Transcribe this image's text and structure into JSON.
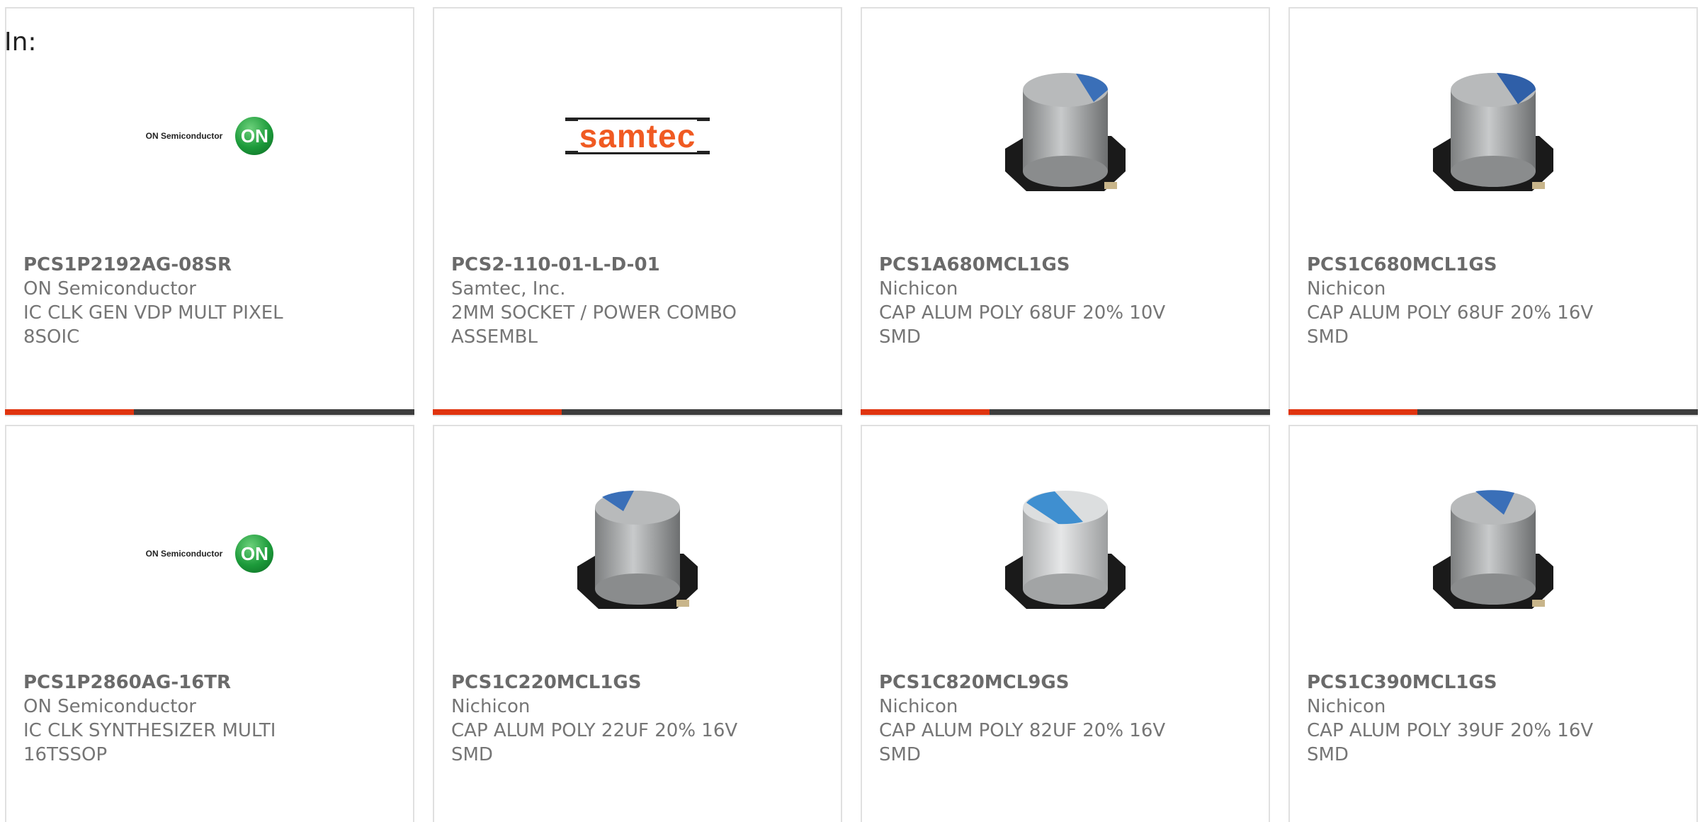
{
  "header": {
    "in_label": "In:"
  },
  "colors": {
    "accent": "#e0340f",
    "bar": "#3d3d3d",
    "card_border": "#e0e0e0",
    "text": "#757575"
  },
  "products": [
    {
      "part_number": "PCS1P2192AG-08SR",
      "manufacturer": "ON Semiconductor",
      "description": "IC CLK GEN VDP MULT PIXEL\n8SOIC",
      "image": "on-semiconductor-logo",
      "logo_text": "ON Semiconductor",
      "logo_mark": "ON"
    },
    {
      "part_number": "PCS2-110-01-L-D-01",
      "manufacturer": "Samtec, Inc.",
      "description": "2MM SOCKET / POWER COMBO\nASSEMBL",
      "image": "samtec-logo",
      "logo_text": "samtec"
    },
    {
      "part_number": "PCS1A680MCL1GS",
      "manufacturer": "Nichicon",
      "description": "CAP ALUM POLY 68UF 20% 10V\nSMD",
      "image": "smd-capacitor"
    },
    {
      "part_number": "PCS1C680MCL1GS",
      "manufacturer": "Nichicon",
      "description": "CAP ALUM POLY 68UF 20% 16V\nSMD",
      "image": "smd-capacitor"
    },
    {
      "part_number": "PCS1P2860AG-16TR",
      "manufacturer": "ON Semiconductor",
      "description": "IC CLK SYNTHESIZER MULTI\n16TSSOP",
      "image": "on-semiconductor-logo",
      "logo_text": "ON Semiconductor",
      "logo_mark": "ON"
    },
    {
      "part_number": "PCS1C220MCL1GS",
      "manufacturer": "Nichicon",
      "description": "CAP ALUM POLY 22UF 20% 16V\nSMD",
      "image": "smd-capacitor"
    },
    {
      "part_number": "PCS1C820MCL9GS",
      "manufacturer": "Nichicon",
      "description": "CAP ALUM POLY 82UF 20% 16V\nSMD",
      "image": "smd-capacitor"
    },
    {
      "part_number": "PCS1C390MCL1GS",
      "manufacturer": "Nichicon",
      "description": "CAP ALUM POLY 39UF 20% 16V\nSMD",
      "image": "smd-capacitor"
    }
  ]
}
